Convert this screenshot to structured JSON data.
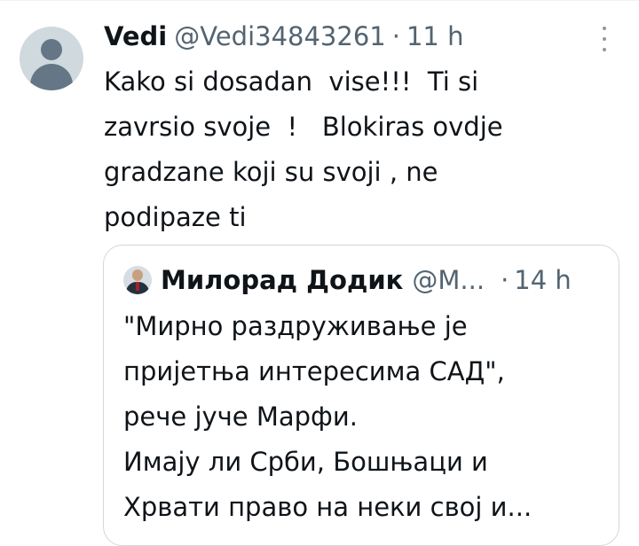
{
  "tweet": {
    "author": {
      "display_name": "Vedi",
      "handle": "@Vedi34843261",
      "separator": "·",
      "time": "11 h",
      "avatar_icon": "default-avatar-icon"
    },
    "more_icon": "more-options-icon",
    "text_lines": [
      "Kako si dosadan  vise!!!  Ti si",
      "zavrsio svoje  !   Blokiras ovdje",
      "gradzane koji su svoji , ne",
      "podipaze ti"
    ]
  },
  "quoted_tweet": {
    "author": {
      "display_name": "Милорад Додик",
      "handle": "@M...",
      "separator": "·",
      "time": "14 h"
    },
    "text_lines": [
      "\"Мирно раздруживање је",
      "пријетња интересима САД\",",
      "рече јуче Марфи.",
      "Имају ли Срби, Бошњаци и",
      "Хрвати право на неки свој и..."
    ]
  },
  "colors": {
    "text_primary": "#0f1419",
    "text_secondary": "#536471",
    "border": "#cfd9de",
    "avatar_bg": "#cfd9de"
  }
}
